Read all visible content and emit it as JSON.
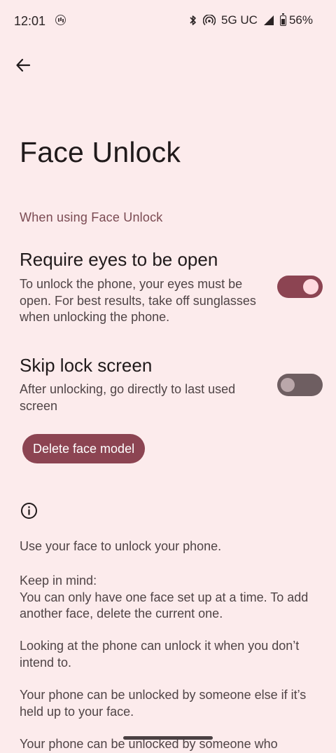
{
  "status_bar": {
    "time": "12:01",
    "network": "5G UC",
    "battery": "56%",
    "icons": [
      "app-notification-icon",
      "bluetooth-icon",
      "hotspot-icon",
      "signal-icon",
      "battery-icon"
    ]
  },
  "header": {
    "back_icon": "arrow-left-icon",
    "title": "Face Unlock"
  },
  "section": {
    "header": "When using Face Unlock"
  },
  "settings": {
    "eyes": {
      "title": "Require eyes to be open",
      "description": "To unlock the phone, your eyes must be open. For best results, take off sunglasses when unlocking the phone.",
      "enabled": true
    },
    "skip": {
      "title": "Skip lock screen",
      "description": "After unlocking, go directly to last used screen",
      "enabled": false
    }
  },
  "actions": {
    "delete_label": "Delete face model"
  },
  "info": {
    "icon": "info-icon",
    "p1": "Use your face to unlock your phone.",
    "p2_heading": "Keep in mind:",
    "p2_body": "You can only have one face set up at a time. To add another face, delete the current one.",
    "p3": "Looking at the phone can unlock it when you don’t intend to.",
    "p4": "Your phone can be unlocked by someone else if it’s held up to your face.",
    "p5": "Your phone can be unlocked by someone who"
  },
  "colors": {
    "background": "#FCEBEC",
    "accent": "#8C4452",
    "section_header": "#7A4A52",
    "toggle_off": "#6E5E61"
  }
}
